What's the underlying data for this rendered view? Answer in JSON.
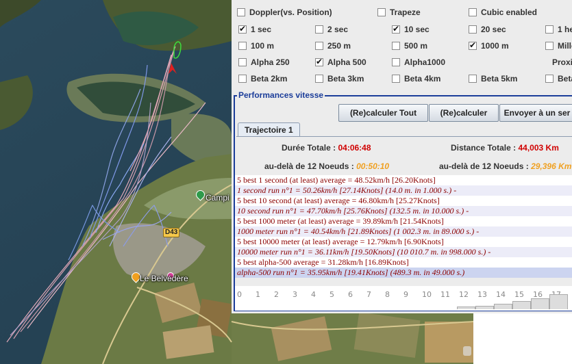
{
  "map": {
    "labels": {
      "camping": "Campi",
      "belvedere": "Le Belvédère",
      "road": "D43"
    }
  },
  "options": {
    "row1": [
      {
        "label": "Doppler(vs. Position)",
        "checked": false
      },
      {
        "label": "Trapeze",
        "checked": false
      },
      {
        "label": "Cubic enabled",
        "checked": false
      }
    ],
    "row2": [
      {
        "label": "1 sec",
        "checked": true
      },
      {
        "label": "2 sec",
        "checked": false
      },
      {
        "label": "10 sec",
        "checked": true
      },
      {
        "label": "20 sec",
        "checked": false
      },
      {
        "label": "1 he",
        "checked": false
      }
    ],
    "row3": [
      {
        "label": "100 m",
        "checked": false
      },
      {
        "label": "250 m",
        "checked": false
      },
      {
        "label": "500 m",
        "checked": false
      },
      {
        "label": "1000 m",
        "checked": true
      },
      {
        "label": "Mille",
        "checked": false
      }
    ],
    "row4": [
      {
        "label": "Alpha 250",
        "checked": false
      },
      {
        "label": "Alpha 500",
        "checked": true
      },
      {
        "label": "Alpha1000",
        "checked": false
      },
      {
        "label": "Proxi",
        "checked": false
      }
    ],
    "row5": [
      {
        "label": "Beta 2km",
        "checked": false
      },
      {
        "label": "Beta 3km",
        "checked": false
      },
      {
        "label": "Beta 4km",
        "checked": false
      },
      {
        "label": "Beta 5km",
        "checked": false
      },
      {
        "label": "Beta",
        "checked": false
      }
    ]
  },
  "performances": {
    "title": "Performances vitesse",
    "buttons": {
      "recalc_all": "(Re)calculer Tout",
      "recalc": "(Re)calculer",
      "send": "Envoyer à un ser"
    },
    "tab": "Trajectoire 1",
    "stats": {
      "duration_label": "Durée Totale :",
      "duration_value": "04:06:48",
      "distance_label": "Distance Totale :",
      "distance_value": "44,003 Km",
      "beyond1_label": "au-delà de",
      "beyond1_knots": "12 Noeuds :",
      "beyond1_value": "00:50:10",
      "beyond2_label": "au-delà de",
      "beyond2_knots": "12 Noeuds :",
      "beyond2_value": "29,396 Km"
    },
    "results": [
      "5 best 1 second (at least) average = 48.52km/h [26.20Knots]",
      "1 second run n°1 = 50.26km/h [27.14Knots] (14.0 m. in 1.000 s.) -",
      "5 best 10 second (at least) average = 46.80km/h [25.27Knots]",
      "10 second run n°1 = 47.70km/h [25.76Knots] (132.5 m. in 10.000 s.) -",
      "5 best 1000 meter (at least) average = 39.89km/h [21.54Knots]",
      "1000 meter run n°1 = 40.54km/h [21.89Knots] (1 002.3 m. in 89.000 s.) -",
      "5 best 10000 meter (at least) average = 12.79km/h [6.90Knots]",
      "10000 meter run n°1 = 36.11km/h [19.50Knots] (10 010.7 m. in 998.000 s.) -",
      "5 best alpha-500 average = 31.28km/h [16.89Knots]",
      "alpha-500 run n°1 = 35.95km/h [19.41Knots] (489.3 m. in 49.000 s.)"
    ],
    "scale_ticks": [
      "0",
      "1",
      "2",
      "3",
      "4",
      "5",
      "6",
      "7",
      "8",
      "9",
      "10",
      "11",
      "12",
      "13",
      "14",
      "15",
      "16",
      "17"
    ],
    "histogram": [
      0,
      0,
      0,
      0,
      0,
      0,
      0,
      0,
      0,
      0,
      0,
      0,
      0.15,
      0.2,
      0.3,
      0.45,
      0.6,
      0.85
    ]
  }
}
